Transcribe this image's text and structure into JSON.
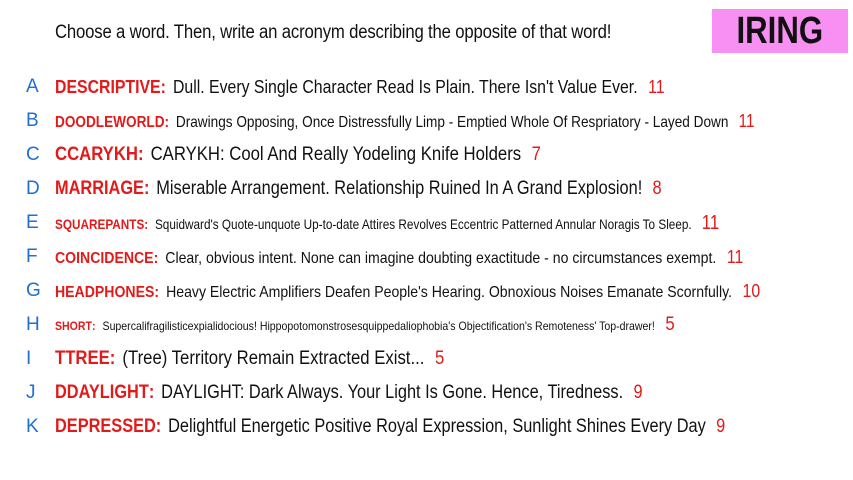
{
  "header": {
    "prompt": "Choose a word. Then, write an acronym describing the opposite of that word!",
    "badge": "IRING"
  },
  "rows": [
    {
      "letter": "A",
      "word": "DESCRIPTIVE",
      "definition": "Dull. Every Single Character Read Is Plain. There Isn't Value Ever.",
      "count": "11"
    },
    {
      "letter": "B",
      "word": "DOODLEWORLD",
      "definition": "Drawings Opposing, Once Distressfully Limp - Emptied Whole Of Respriatory - Layed Down",
      "count": "11"
    },
    {
      "letter": "C",
      "word": "CCARYKH",
      "definition": "CARYKH: Cool And Really Yodeling Knife Holders",
      "count": "7"
    },
    {
      "letter": "D",
      "word": "MARRIAGE",
      "definition": "Miserable Arrangement. Relationship Ruined In A Grand Explosion!",
      "count": "8"
    },
    {
      "letter": "E",
      "word": "SQUAREPANTS",
      "definition": "Squidward's Quote-unquote Up-to-date Attires Revolves Eccentric Patterned Annular Noragis To Sleep.",
      "count": "11"
    },
    {
      "letter": "F",
      "word": "COINCIDENCE",
      "definition": "Clear, obvious intent. None can imagine doubting exactitude - no circumstances exempt.",
      "count": "11"
    },
    {
      "letter": "G",
      "word": "HEADPHONES",
      "definition": "Heavy Electric Amplifiers Deafen People's Hearing. Obnoxious Noises Emanate Scornfully.",
      "count": "10"
    },
    {
      "letter": "H",
      "word": "SHORT",
      "definition": "Supercalifragilisticexpialidocious! Hippopotomonstrosesquippedaliophobia's Objectification's Remoteness' Top-drawer!",
      "count": "5"
    },
    {
      "letter": "I",
      "word": "TTREE",
      "definition": "(Tree) Territory Remain Extracted Exist...",
      "count": "5"
    },
    {
      "letter": "J",
      "word": "DDAYLIGHT",
      "definition": "DAYLIGHT: Dark Always. Your Light Is Gone. Hence, Tiredness.",
      "count": "9"
    },
    {
      "letter": "K",
      "word": "DEPRESSED",
      "definition": "Delightful Energetic Positive Royal Expression, Sunlight Shines Every Day",
      "count": "9"
    }
  ],
  "colors": {
    "letter": "#1f6fd0",
    "word": "#e21a1a",
    "count": "#e21a1a",
    "badge_bg": "#f88ff2",
    "text": "#111111"
  }
}
